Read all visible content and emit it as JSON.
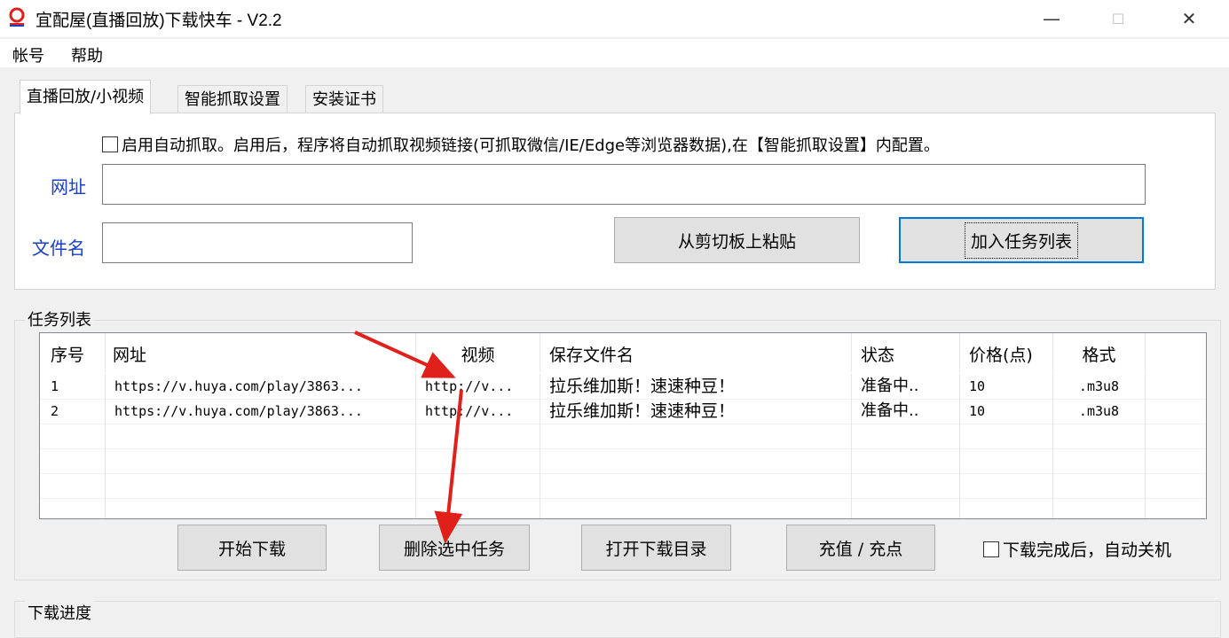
{
  "window": {
    "title": "宜配屋(直播回放)下载快车 - V2.2",
    "minimize": "—",
    "maximize": "☐",
    "close": "✕"
  },
  "menu": [
    "帐号",
    "帮助"
  ],
  "tabs": [
    "直播回放/小视频",
    "智能抓取设置",
    "安装证书"
  ],
  "panel": {
    "auto_capture_label": "启用自动抓取。启用后，程序将自动抓取视频链接(可抓取微信/IE/Edge等浏览器数据),在【智能抓取设置】内配置。",
    "auto_capture_checked": false,
    "url_label": "网址",
    "url_value": "",
    "filename_label": "文件名",
    "filename_value": "",
    "paste_button": "从剪切板上粘贴",
    "add_button": "加入任务列表"
  },
  "task_list": {
    "title": "任务列表",
    "columns": [
      "序号",
      "网址",
      "视频",
      "保存文件名",
      "状态",
      "价格(点)",
      "格式"
    ],
    "rows": [
      [
        "1",
        "https://v.huya.com/play/3863...",
        "http://v...",
        "拉乐维加斯！速速种豆！",
        "准备中..",
        "10",
        ".m3u8"
      ],
      [
        "2",
        "https://v.huya.com/play/3863...",
        "http://v...",
        "拉乐维加斯！速速种豆！",
        "准备中..",
        "10",
        ".m3u8"
      ]
    ],
    "buttons": {
      "start": "开始下载",
      "delete": "删除选中任务",
      "open_dir": "打开下载目录",
      "recharge": "充值 / 充点"
    },
    "auto_shutdown_label": "下载完成后，自动关机",
    "auto_shutdown_checked": false
  },
  "progress_section_title": "下载进度",
  "colors": {
    "accent_blue": "#1a3fbf",
    "annotation_red": "#e0201b",
    "focus_border": "#0078d7"
  }
}
